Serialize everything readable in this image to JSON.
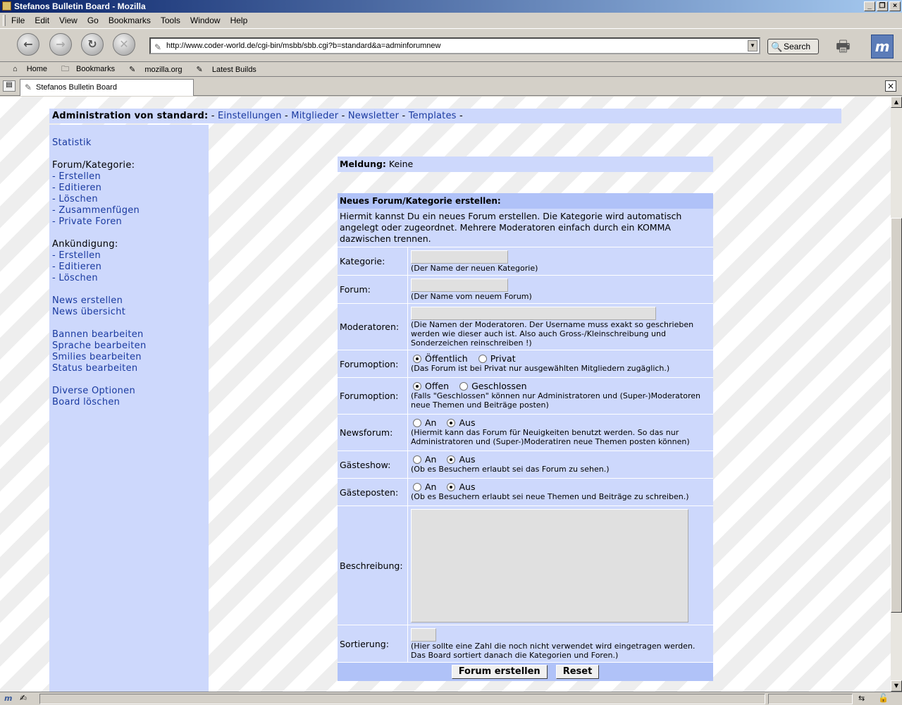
{
  "window": {
    "title": "Stefanos Bulletin Board - Mozilla"
  },
  "menu": [
    "File",
    "Edit",
    "View",
    "Go",
    "Bookmarks",
    "Tools",
    "Window",
    "Help"
  ],
  "toolbar": {
    "url": "http://www.coder-world.de/cgi-bin/msbb/sbb.cgi?b=standard&a=adminforumnew",
    "search_label": "Search"
  },
  "bookmarks": [
    "Home",
    "Bookmarks",
    "mozilla.org",
    "Latest Builds"
  ],
  "tab": {
    "title": "Stefanos Bulletin Board"
  },
  "topnav": {
    "heading": "Administration von standard:",
    "sep": "-",
    "links": [
      "Einstellungen",
      "Mitglieder",
      "Newsletter",
      "Templates"
    ]
  },
  "sidebar": {
    "statistik": "Statistik",
    "forum_heading": "Forum/Kategorie:",
    "forum_items": [
      "- Erstellen",
      "- Editieren",
      "- Löschen",
      "- Zusammenfügen",
      "- Private Foren"
    ],
    "ank_heading": "Ankündigung:",
    "ank_items": [
      "- Erstellen",
      "- Editieren",
      "- Löschen"
    ],
    "news": [
      "News erstellen",
      "News übersicht"
    ],
    "edit": [
      "Bannen bearbeiten",
      "Sprache bearbeiten",
      "Smilies bearbeiten",
      "Status bearbeiten"
    ],
    "misc": [
      "Diverse Optionen",
      "Board löschen"
    ]
  },
  "meldung": {
    "label": "Meldung:",
    "value": "Keine"
  },
  "form": {
    "title": "Neues Forum/Kategorie erstellen:",
    "intro": "Hiermit kannst Du ein neues Forum erstellen. Die Kategorie wird automatisch angelegt oder zugeordnet. Mehrere Moderatoren einfach durch ein KOMMA dazwischen trennen.",
    "kategorie": {
      "label": "Kategorie:",
      "help": "(Der Name der neuen Kategorie)",
      "value": ""
    },
    "forum": {
      "label": "Forum:",
      "help": "(Der Name vom neuem Forum)",
      "value": ""
    },
    "moderatoren": {
      "label": "Moderatoren:",
      "help": "(Die Namen der Moderatoren. Der Username muss exakt so geschrieben werden wie dieser auch ist. Also auch Gross-/Kleinschreibung und Sonderzeichen reinschreiben !)",
      "value": ""
    },
    "forumoption1": {
      "label": "Forumoption:",
      "opt_a": "Öffentlich",
      "opt_b": "Privat",
      "selected": "a",
      "help": "(Das Forum ist bei Privat nur ausgewählten Mitgliedern zugäglich.)"
    },
    "forumoption2": {
      "label": "Forumoption:",
      "opt_a": "Offen",
      "opt_b": "Geschlossen",
      "selected": "a",
      "help": "(Falls \"Geschlossen\" können nur Administratoren und (Super-)Moderatoren neue Themen und Beiträge posten)"
    },
    "newsforum": {
      "label": "Newsforum:",
      "opt_a": "An",
      "opt_b": "Aus",
      "selected": "b",
      "help": "(Hiermit kann das Forum für Neuigkeiten benutzt werden. So das nur Administratoren und (Super-)Moderatiren neue Themen posten können)"
    },
    "gaesteshow": {
      "label": "Gästeshow:",
      "opt_a": "An",
      "opt_b": "Aus",
      "selected": "b",
      "help": "(Ob es Besuchern erlaubt sei das Forum zu sehen.)"
    },
    "gaesteposten": {
      "label": "Gästeposten:",
      "opt_a": "An",
      "opt_b": "Aus",
      "selected": "b",
      "help": "(Ob es Besuchern erlaubt sei neue Themen und Beiträge zu schreiben.)"
    },
    "beschreibung": {
      "label": "Beschreibung:",
      "value": ""
    },
    "sortierung": {
      "label": "Sortierung:",
      "help": "(Hier sollte eine Zahl die noch nicht verwendet wird eingetragen werden. Das Board sortiert danach die Kategorien und Foren.)",
      "value": ""
    },
    "submit_label": "Forum erstellen",
    "reset_label": "Reset"
  }
}
